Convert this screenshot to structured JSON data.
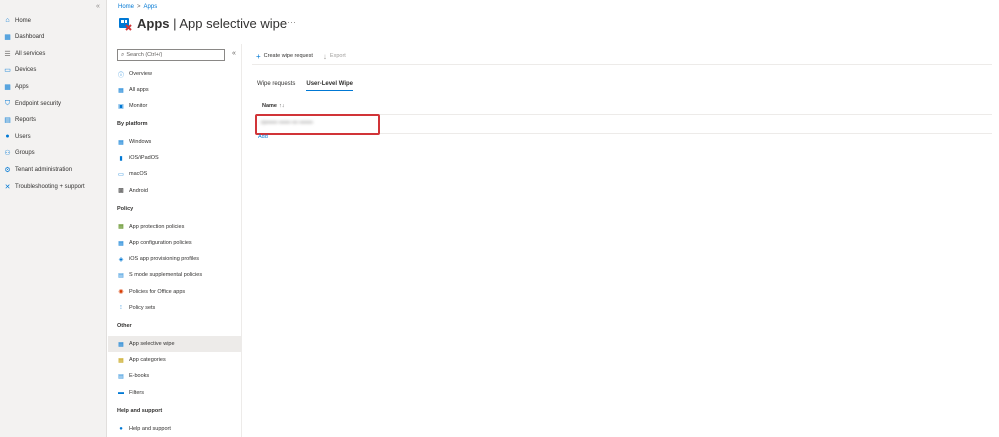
{
  "global_nav": {
    "items": [
      {
        "label": "Home",
        "icon": "home-icon",
        "color": "#0078d4"
      },
      {
        "label": "Dashboard",
        "icon": "dashboard-icon",
        "color": "#0078d4"
      },
      {
        "label": "All services",
        "icon": "list-icon",
        "color": "#605e5c"
      },
      {
        "label": "Devices",
        "icon": "devices-icon",
        "color": "#0078d4"
      },
      {
        "label": "Apps",
        "icon": "apps-icon",
        "color": "#0078d4"
      },
      {
        "label": "Endpoint security",
        "icon": "shield-icon",
        "color": "#0078d4"
      },
      {
        "label": "Reports",
        "icon": "reports-icon",
        "color": "#0078d4"
      },
      {
        "label": "Users",
        "icon": "user-icon",
        "color": "#0078d4"
      },
      {
        "label": "Groups",
        "icon": "groups-icon",
        "color": "#0078d4"
      },
      {
        "label": "Tenant administration",
        "icon": "tenant-icon",
        "color": "#0078d4"
      },
      {
        "label": "Troubleshooting + support",
        "icon": "wrench-icon",
        "color": "#0078d4"
      }
    ]
  },
  "header": {
    "breadcrumb": [
      "Home",
      "Apps"
    ],
    "title_bold": "Apps",
    "title_rest": " | App selective wipe",
    "more": "···"
  },
  "resource_menu": {
    "search_placeholder": "Search (Ctrl+/)",
    "collapse": "«",
    "top_items": [
      {
        "label": "Overview",
        "icon": "info-icon"
      },
      {
        "label": "All apps",
        "icon": "apps-grid-icon"
      },
      {
        "label": "Monitor",
        "icon": "monitor-icon"
      }
    ],
    "sections": [
      {
        "title": "By platform",
        "items": [
          {
            "label": "Windows",
            "icon": "windows-icon"
          },
          {
            "label": "iOS/iPadOS",
            "icon": "phone-icon"
          },
          {
            "label": "macOS",
            "icon": "laptop-icon"
          },
          {
            "label": "Android",
            "icon": "android-icon"
          }
        ]
      },
      {
        "title": "Policy",
        "items": [
          {
            "label": "App protection policies",
            "icon": "app-protection-icon"
          },
          {
            "label": "App configuration policies",
            "icon": "app-config-icon"
          },
          {
            "label": "iOS app provisioning profiles",
            "icon": "provisioning-icon"
          },
          {
            "label": "S mode supplemental policies",
            "icon": "s-mode-icon"
          },
          {
            "label": "Policies for Office apps",
            "icon": "office-icon"
          },
          {
            "label": "Policy sets",
            "icon": "policy-sets-icon"
          }
        ]
      },
      {
        "title": "Other",
        "items": [
          {
            "label": "App selective wipe",
            "icon": "wipe-icon",
            "active": true
          },
          {
            "label": "App categories",
            "icon": "categories-icon"
          },
          {
            "label": "E-books",
            "icon": "ebook-icon"
          },
          {
            "label": "Filters",
            "icon": "filter-icon"
          }
        ]
      },
      {
        "title": "Help and support",
        "items": [
          {
            "label": "Help and support",
            "icon": "help-user-icon"
          }
        ]
      }
    ]
  },
  "content": {
    "toolbar": {
      "create_label": "Create wipe request",
      "export_label": "Export"
    },
    "tabs": [
      {
        "label": "Wipe requests",
        "active": false
      },
      {
        "label": "User-Level Wipe",
        "active": true
      }
    ],
    "table": {
      "column_name": "Name",
      "sort_glyph": "↑↓",
      "rows": [
        "ro•••••• •••••• ••• •••••••"
      ]
    },
    "add_label": "Add"
  },
  "colors": {
    "accent": "#0078d4",
    "highlight_border": "#d13438"
  }
}
